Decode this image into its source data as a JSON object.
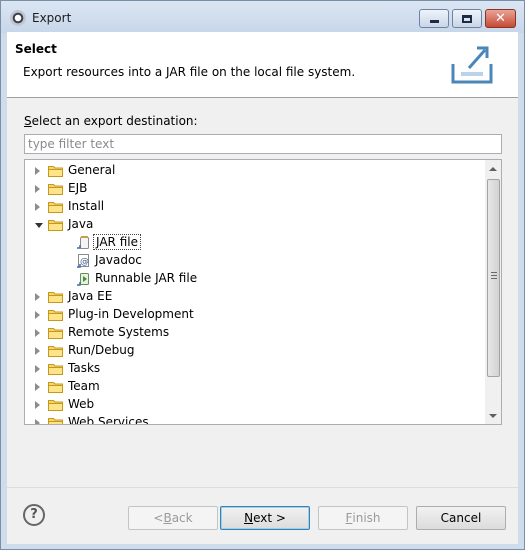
{
  "window": {
    "title": "Export"
  },
  "titlebar": {
    "close_glyph": "✕"
  },
  "banner": {
    "title": "Select",
    "description": "Export resources into a JAR file on the local file system."
  },
  "destination": {
    "label_mnemonic": "S",
    "label_rest": "elect an export destination:",
    "filter_placeholder": "type filter text"
  },
  "tree": {
    "items": [
      {
        "label": "General",
        "type": "folder",
        "expanded": false,
        "indent": 0
      },
      {
        "label": "EJB",
        "type": "folder",
        "expanded": false,
        "indent": 0
      },
      {
        "label": "Install",
        "type": "folder",
        "expanded": false,
        "indent": 0
      },
      {
        "label": "Java",
        "type": "folder",
        "expanded": true,
        "indent": 0
      },
      {
        "label": "JAR file",
        "type": "jar",
        "indent": 1,
        "selected": true
      },
      {
        "label": "Javadoc",
        "type": "javadoc",
        "indent": 1
      },
      {
        "label": "Runnable JAR file",
        "type": "runnable-jar",
        "indent": 1
      },
      {
        "label": "Java EE",
        "type": "folder",
        "expanded": false,
        "indent": 0
      },
      {
        "label": "Plug-in Development",
        "type": "folder",
        "expanded": false,
        "indent": 0
      },
      {
        "label": "Remote Systems",
        "type": "folder",
        "expanded": false,
        "indent": 0
      },
      {
        "label": "Run/Debug",
        "type": "folder",
        "expanded": false,
        "indent": 0
      },
      {
        "label": "Tasks",
        "type": "folder",
        "expanded": false,
        "indent": 0
      },
      {
        "label": "Team",
        "type": "folder",
        "expanded": false,
        "indent": 0
      },
      {
        "label": "Web",
        "type": "folder",
        "expanded": false,
        "indent": 0
      },
      {
        "label": "Web Services",
        "type": "folder",
        "expanded": false,
        "indent": 0
      }
    ]
  },
  "help": {
    "glyph": "?"
  },
  "buttons": {
    "back": {
      "prefix": "< ",
      "mnemonic": "B",
      "rest": "ack",
      "enabled": false
    },
    "next": {
      "prefix": "",
      "mnemonic": "N",
      "rest": "ext >",
      "enabled": true
    },
    "finish": {
      "prefix": "",
      "mnemonic": "F",
      "rest": "inish",
      "enabled": false
    },
    "cancel": {
      "label": "Cancel",
      "enabled": true
    }
  }
}
